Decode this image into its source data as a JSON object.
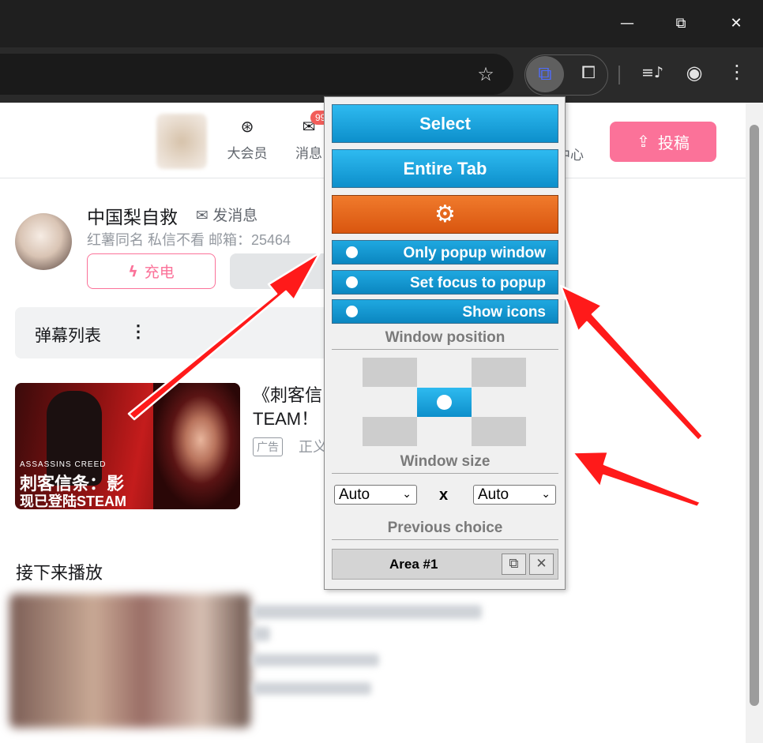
{
  "window_controls": {
    "minimize": "—",
    "restore": "⧉",
    "close": "✕"
  },
  "toolbar": {
    "bookmark_icon": "☆",
    "extension_icon": "⧉",
    "puzzle_icon": "⧠",
    "playlist_icon": "≡♪",
    "profile_icon": "◉",
    "menu_icon": "⋮"
  },
  "header": {
    "nav": [
      {
        "icon": "⊛",
        "label": "大会员"
      },
      {
        "icon": "✉",
        "label": "消息"
      }
    ],
    "badge": "99",
    "creator_partial": "中心",
    "upload_label": "投稿",
    "upload_icon": "⇪"
  },
  "uploader": {
    "name": "中国梨自救",
    "message_label": "发消息",
    "message_icon": "✉",
    "description": "红薯同名 私信不看 邮箱：25464",
    "charge_label": "充电",
    "charge_icon": "ϟ"
  },
  "danmaku": {
    "label": "弹幕列表",
    "more_icon": "⋮"
  },
  "ad": {
    "thumb_line1": "ASSASSINS CREED",
    "thumb_line2": "刺客信条：影",
    "thumb_line3": "现已登陆STEAM",
    "title": "《刺客信 TEAM！",
    "badge": "广告",
    "meta": "正义"
  },
  "next_up": {
    "title": "接下来播放"
  },
  "popup": {
    "select_label": "Select",
    "entire_tab_label": "Entire Tab",
    "settings_icon": "⚙",
    "toggles": [
      {
        "label": "Only popup window"
      },
      {
        "label": "Set focus to popup"
      },
      {
        "label": "Show icons"
      }
    ],
    "window_position_label": "Window position",
    "window_size_label": "Window size",
    "width_value": "Auto",
    "height_value": "Auto",
    "times_label": "x",
    "previous_choice_label": "Previous choice",
    "area_label": "Area #1",
    "copy_icon": "⧉",
    "delete_icon": "✕"
  },
  "colors": {
    "accent_pink": "#fb7299",
    "popup_blue": "#0d8fcb",
    "popup_orange": "#e0621a",
    "arrow_red": "#ff1a1a"
  }
}
